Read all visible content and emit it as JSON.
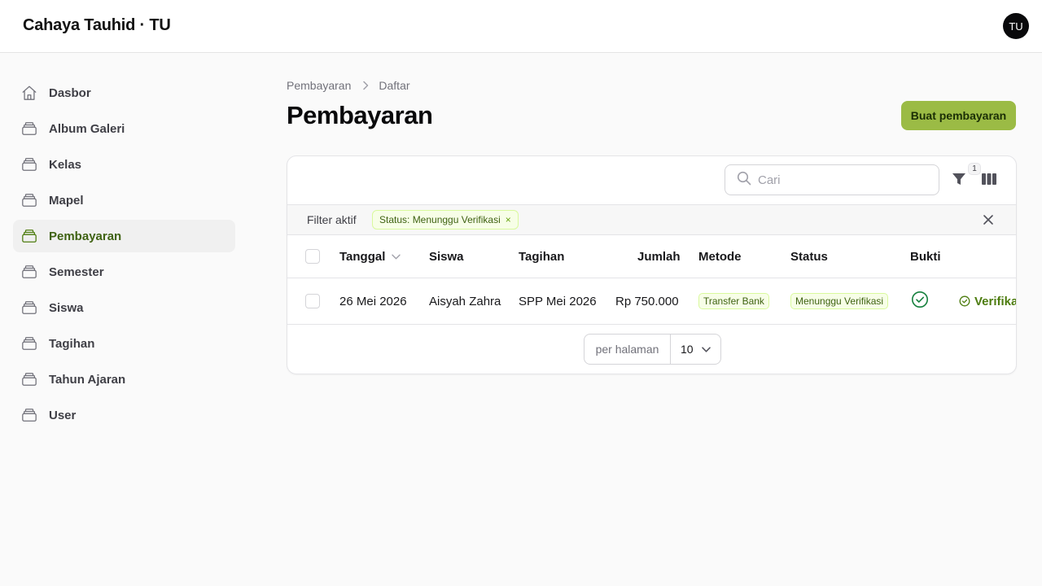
{
  "app": {
    "brand": "Cahaya Tauhid · TU",
    "avatar_initials": "TU"
  },
  "sidebar": {
    "items": [
      {
        "label": "Dasbor",
        "icon": "home-icon",
        "active": false
      },
      {
        "label": "Album Galeri",
        "icon": "stack-icon",
        "active": false
      },
      {
        "label": "Kelas",
        "icon": "stack-icon",
        "active": false
      },
      {
        "label": "Mapel",
        "icon": "stack-icon",
        "active": false
      },
      {
        "label": "Pembayaran",
        "icon": "stack-icon",
        "active": true
      },
      {
        "label": "Semester",
        "icon": "stack-icon",
        "active": false
      },
      {
        "label": "Siswa",
        "icon": "stack-icon",
        "active": false
      },
      {
        "label": "Tagihan",
        "icon": "stack-icon",
        "active": false
      },
      {
        "label": "Tahun Ajaran",
        "icon": "stack-icon",
        "active": false
      },
      {
        "label": "User",
        "icon": "stack-icon",
        "active": false
      }
    ]
  },
  "breadcrumb": {
    "parent": "Pembayaran",
    "current": "Daftar"
  },
  "page": {
    "title": "Pembayaran",
    "create_button": "Buat pembayaran"
  },
  "toolbar": {
    "search_placeholder": "Cari",
    "filter_count": "1"
  },
  "filters": {
    "label": "Filter aktif",
    "chips": [
      "Status: Menunggu Verifikasi"
    ],
    "chip_remove": "×"
  },
  "table": {
    "columns": [
      "Tanggal",
      "Siswa",
      "Tagihan",
      "Jumlah",
      "Metode",
      "Status",
      "Bukti"
    ],
    "rows": [
      {
        "tanggal": "26 Mei 2026",
        "siswa": "Aisyah Zahra",
        "tagihan": "SPP Mei 2026",
        "jumlah": "Rp 750.000",
        "metode": "Transfer Bank",
        "status": "Menunggu Verifikasi",
        "bukti_icon": "check-circle-icon",
        "action": "Verifikasi"
      }
    ]
  },
  "pagination": {
    "per_page_label": "per halaman",
    "per_page_value": "10"
  },
  "colors": {
    "accent": "#9bbb45",
    "active_text": "#3f6212",
    "badge_bg": "#f7fee7",
    "badge_border": "#d9f99d",
    "success": "#15803d"
  }
}
